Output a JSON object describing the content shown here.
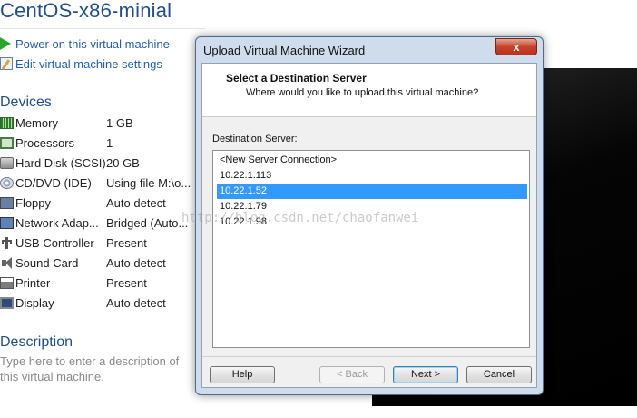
{
  "vm": {
    "title": "CentOS-x86-minial",
    "commands": [
      {
        "label": "Power on this virtual machine",
        "icon": "play-icon"
      },
      {
        "label": "Edit virtual machine settings",
        "icon": "edit-settings-icon"
      }
    ],
    "devices_heading": "Devices",
    "devices": [
      {
        "name": "Memory",
        "value": "1 GB",
        "icon": "memory-icon"
      },
      {
        "name": "Processors",
        "value": "1",
        "icon": "processor-icon"
      },
      {
        "name": "Hard Disk (SCSI)",
        "value": "20 GB",
        "icon": "hard-disk-icon"
      },
      {
        "name": "CD/DVD (IDE)",
        "value": "Using file M:\\o...",
        "icon": "cd-dvd-icon"
      },
      {
        "name": "Floppy",
        "value": "Auto detect",
        "icon": "floppy-icon"
      },
      {
        "name": "Network Adap...",
        "value": "Bridged (Auto...",
        "icon": "network-adapter-icon"
      },
      {
        "name": "USB Controller",
        "value": "Present",
        "icon": "usb-icon"
      },
      {
        "name": "Sound Card",
        "value": "Auto detect",
        "icon": "sound-card-icon"
      },
      {
        "name": "Printer",
        "value": "Present",
        "icon": "printer-icon"
      },
      {
        "name": "Display",
        "value": "Auto detect",
        "icon": "display-icon"
      }
    ],
    "description_heading": "Description",
    "description_placeholder": "Type here to enter a description of this virtual machine."
  },
  "dialog": {
    "title": "Upload Virtual Machine Wizard",
    "close_label": "x",
    "header_title": "Select a Destination Server",
    "header_subtitle": "Where would you like to upload this virtual machine?",
    "destination_label": "Destination Server:",
    "servers": [
      "<New Server Connection>",
      "10.22.1.113",
      "10.22.1.52",
      "10.22.1.79",
      "10.22.1.98"
    ],
    "selected_server": "10.22.1.52",
    "buttons": {
      "help": "Help",
      "back": "< Back",
      "next": "Next >",
      "cancel": "Cancel"
    }
  },
  "watermark": "http://blog.csdn.net/chaofanwei"
}
